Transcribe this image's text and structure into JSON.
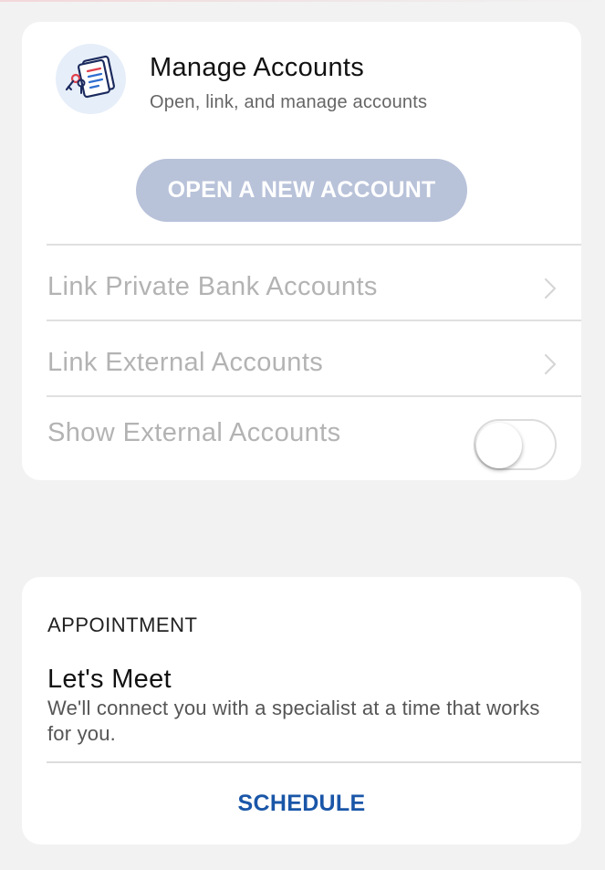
{
  "manage": {
    "icon": "document-keys-icon",
    "title": "Manage Accounts",
    "subtitle": "Open, link, and manage accounts",
    "open_button": "OPEN A NEW ACCOUNT",
    "rows": [
      {
        "label": "Link Private Bank Accounts",
        "icon": "chevron-right-icon"
      },
      {
        "label": "Link External Accounts",
        "icon": "chevron-right-icon"
      }
    ],
    "toggle_row": {
      "label": "Show External Accounts",
      "enabled": false
    }
  },
  "appointment": {
    "section_label": "APPOINTMENT",
    "title": "Let's Meet",
    "body": "We'll connect you with a specialist at a time that works for you.",
    "schedule_button": "SCHEDULE"
  },
  "colors": {
    "page_background": "#f2f2f2",
    "card_background": "#ffffff",
    "open_button_bg": "#b8c2d9",
    "disabled_text": "#b3b3b3",
    "link_accent": "#1a56a8",
    "icon_circle": "#e6eef9"
  }
}
